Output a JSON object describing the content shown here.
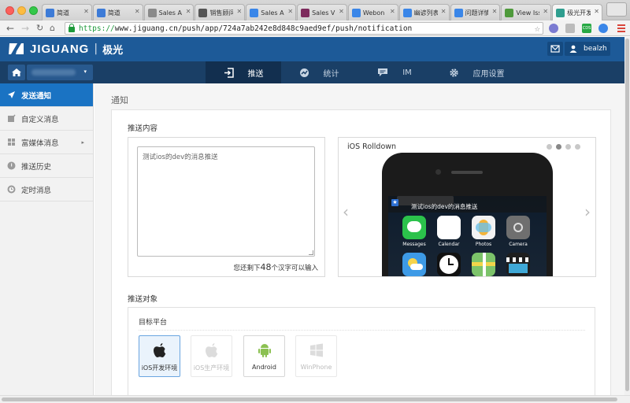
{
  "browser": {
    "tabs": [
      {
        "label": "简道",
        "favicon_color": "#3d7bd7"
      },
      {
        "label": "简道",
        "favicon_color": "#3d7bd7"
      },
      {
        "label": "Sales Ap",
        "favicon_color": "#8a8a8a"
      },
      {
        "label": "销售顾问",
        "favicon_color": "#555555"
      },
      {
        "label": "Sales Ap",
        "favicon_color": "#3a86e8"
      },
      {
        "label": "Sales Vi",
        "favicon_color": "#7d2a5c"
      },
      {
        "label": "Webon",
        "favicon_color": "#3a86e8"
      },
      {
        "label": "幽谚列表",
        "favicon_color": "#3a86e8"
      },
      {
        "label": "问题详情",
        "favicon_color": "#3a86e8"
      },
      {
        "label": "View Iss",
        "favicon_color": "#4f9a3c"
      },
      {
        "label": "极光开发",
        "favicon_color": "#2f9e8f"
      }
    ],
    "url_scheme": "https://",
    "url_rest": "www.jiguang.cn/push/app/724a7ab242e8d848c9aed9ef/push/notification",
    "ext_label": "CDS"
  },
  "header": {
    "logo_text": "JIGUANG",
    "logo_sep": "|",
    "logo_cn": "极光",
    "username": "bealzh"
  },
  "nav": {
    "app_caret": "▾",
    "tabs": [
      {
        "label": "推送",
        "icon": "push-icon",
        "active": true
      },
      {
        "label": "统计",
        "icon": "chart-icon",
        "active": false
      },
      {
        "label": "IM",
        "icon": "chat-icon",
        "active": false
      },
      {
        "label": "应用设置",
        "icon": "gear-icon",
        "active": false
      }
    ]
  },
  "sidebar": {
    "items": [
      {
        "label": "发送通知",
        "icon": "send-icon",
        "active": true
      },
      {
        "label": "自定义消息",
        "icon": "edit-icon",
        "active": false
      },
      {
        "label": "富媒体消息",
        "icon": "grid-icon",
        "active": false,
        "caret": "▸"
      },
      {
        "label": "推送历史",
        "icon": "history-icon",
        "active": false
      },
      {
        "label": "定时消息",
        "icon": "clock-icon",
        "active": false
      }
    ]
  },
  "main": {
    "page_title": "通知",
    "content_label": "推送内容",
    "message_text": "测试ios的dev的消息推送",
    "counter_prefix": "您还剩下",
    "counter_value": "48",
    "counter_suffix": "个汉字可以输入",
    "preview": {
      "title": "iOS Rolldown",
      "dots": 4,
      "active_dot": 1,
      "prev": "‹",
      "next": "›",
      "notif_badge": "★",
      "notif_text": "测试ios的dev的消息推送",
      "apps": [
        {
          "name": "Messages",
          "color": "#2bc24b"
        },
        {
          "name": "Calendar",
          "color": "#ffffff"
        },
        {
          "name": "Photos",
          "color": "#f2f2f2"
        },
        {
          "name": "Camera",
          "color": "#6f6f6f"
        },
        {
          "name": "Weather",
          "color": "#3d9ae6"
        },
        {
          "name": "Clock",
          "color": "#111111"
        },
        {
          "name": "Maps",
          "color": "#7cc36a"
        },
        {
          "name": "Videos",
          "color": "#1e1e1e"
        }
      ]
    },
    "target_label": "推送对象",
    "platform_label": "目标平台",
    "platforms": [
      {
        "label": "iOS开发环境",
        "state": "active"
      },
      {
        "label": "iOS生产环境",
        "state": "disabled"
      },
      {
        "label": "Android",
        "state": "normal"
      },
      {
        "label": "WinPhone",
        "state": "disabled"
      }
    ]
  }
}
